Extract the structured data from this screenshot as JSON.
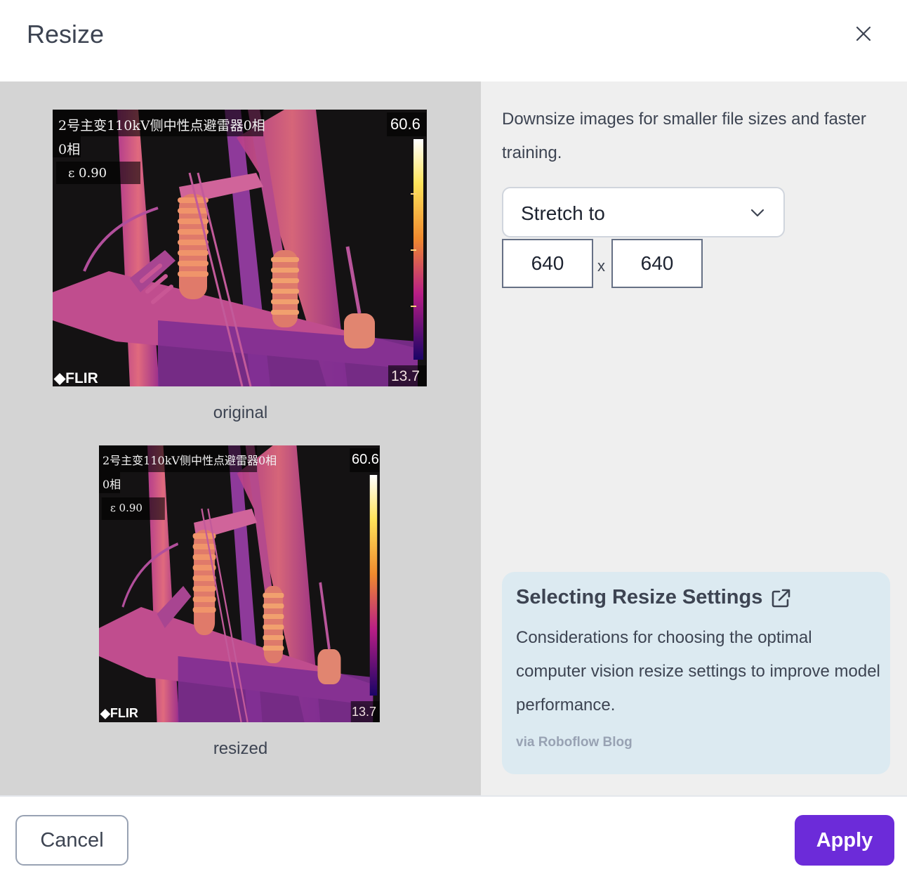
{
  "dialog": {
    "title": "Resize"
  },
  "preview": {
    "original_caption": "original",
    "resized_caption": "resized",
    "image_overlay": {
      "title_line": "2号主变110kV侧中性点避雷器0相",
      "phase_line": "0相",
      "emissivity": "ε  0.90",
      "temp_max": "60.6",
      "temp_min": "13.7",
      "brand": "FLIR"
    }
  },
  "settings": {
    "description": "Downsize images for smaller file sizes and faster training.",
    "mode_select": {
      "value": "Stretch to"
    },
    "width": "640",
    "height": "640",
    "times_symbol": "x"
  },
  "resource_card": {
    "title": "Selecting Resize Settings",
    "body": "Considerations for choosing the optimal computer vision resize settings to improve model performance.",
    "source": "via Roboflow Blog"
  },
  "footer": {
    "cancel_label": "Cancel",
    "apply_label": "Apply"
  },
  "colors": {
    "accent": "#6c2bd9",
    "card_background": "#dceaf1"
  }
}
